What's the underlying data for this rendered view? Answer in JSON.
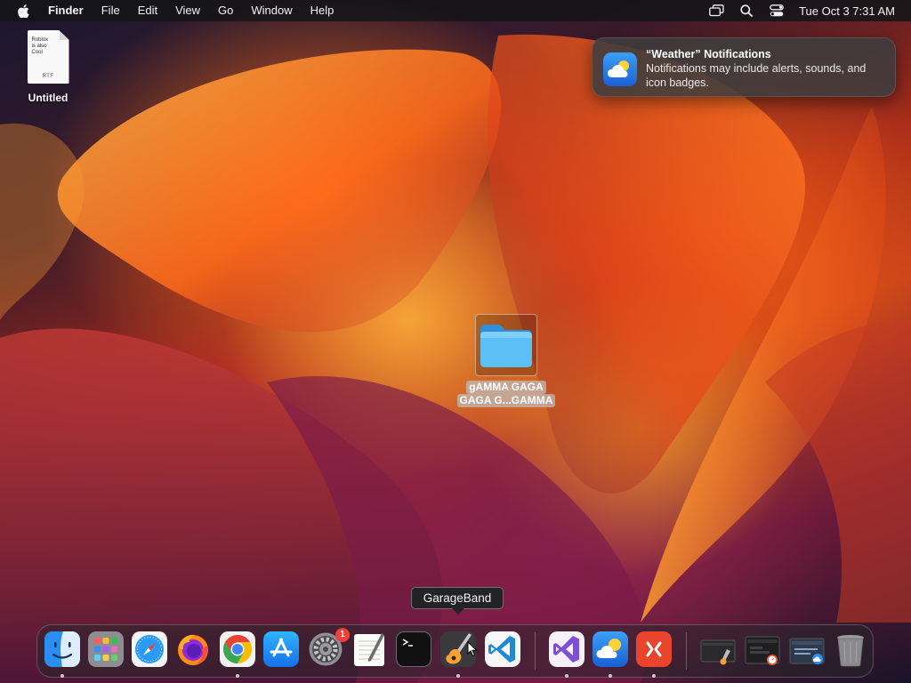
{
  "menubar": {
    "apple_icon": "apple-logo-icon",
    "app_name": "Finder",
    "menus": [
      "File",
      "Edit",
      "View",
      "Go",
      "Window",
      "Help"
    ],
    "status_icons": [
      "screen-mirroring-icon",
      "spotlight-search-icon",
      "control-center-icon"
    ],
    "clock": "Tue Oct 3  7:31 AM"
  },
  "desktop": {
    "file": {
      "name": "Untitled",
      "preview_text": "Roblox\nis also\nCool",
      "kind": "RTF",
      "icon": "rtf-document-icon"
    },
    "folder": {
      "name_line1": "gAMMA GAGA",
      "name_line2": "GAGA G...GAMMA",
      "icon": "folder-icon",
      "selected": true
    }
  },
  "notification": {
    "app_icon": "weather-icon",
    "title": "“Weather” Notifications",
    "body": "Notifications may include alerts, sounds, and icon badges."
  },
  "tooltip": {
    "text": "GarageBand"
  },
  "dock": {
    "apps": [
      {
        "name": "Finder",
        "icon": "finder-icon",
        "running": true
      },
      {
        "name": "Launchpad",
        "icon": "launchpad-icon",
        "running": false
      },
      {
        "name": "Safari",
        "icon": "safari-icon",
        "running": false
      },
      {
        "name": "Firefox",
        "icon": "firefox-icon",
        "running": false
      },
      {
        "name": "Google Chrome",
        "icon": "chrome-icon",
        "running": true
      },
      {
        "name": "App Store",
        "icon": "app-store-icon",
        "running": false
      },
      {
        "name": "System Settings",
        "icon": "system-settings-icon",
        "running": false,
        "badge": "1"
      },
      {
        "name": "TextEdit",
        "icon": "textedit-icon",
        "running": false
      },
      {
        "name": "Terminal",
        "icon": "terminal-icon",
        "running": false
      },
      {
        "name": "GarageBand",
        "icon": "garageband-icon",
        "running": true
      },
      {
        "name": "Visual Studio Code",
        "icon": "vscode-icon",
        "running": false
      }
    ],
    "recent_apps": [
      {
        "name": "Visual Studio",
        "icon": "visual-studio-icon",
        "running": true
      },
      {
        "name": "Weather",
        "icon": "weather-icon",
        "running": true
      },
      {
        "name": "Remote Desktop",
        "icon": "remote-desktop-icon",
        "running": true
      }
    ],
    "minimized": [
      {
        "name": "GarageBand window",
        "icon": "minimized-window-icon"
      },
      {
        "name": "Safari window",
        "icon": "minimized-window-icon"
      },
      {
        "name": "Weather window",
        "icon": "minimized-window-icon"
      },
      {
        "name": "Trash",
        "icon": "trash-icon"
      }
    ]
  },
  "colors": {
    "menubar_bg": "#141418",
    "notification_bg": "#3e3c3e",
    "badge_red": "#f0403a",
    "folder_blue": "#4fb3f2",
    "wallpaper_orange": "#ff8a1a",
    "wallpaper_purple": "#6e1a3a"
  }
}
